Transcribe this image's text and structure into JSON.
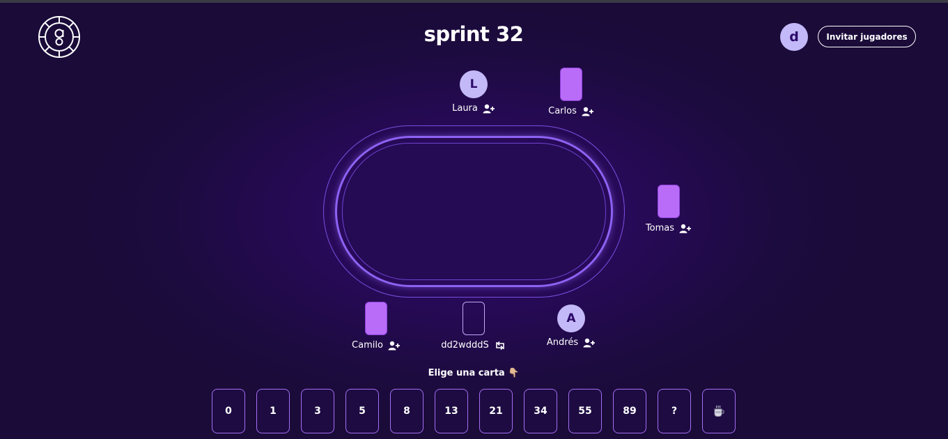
{
  "header": {
    "title": "sprint 32",
    "user_initial": "d",
    "invite_label": "Invitar jugadores"
  },
  "players": [
    {
      "name": "Laura",
      "avatar": "L",
      "state": "avatar",
      "action_icon": "add-user-icon"
    },
    {
      "name": "Carlos",
      "state": "card",
      "action_icon": "add-user-icon"
    },
    {
      "name": "Tomas",
      "state": "card",
      "action_icon": "add-user-icon"
    },
    {
      "name": "Camilo",
      "state": "card",
      "action_icon": "add-user-icon"
    },
    {
      "name": "dd2wdddS",
      "state": "empty-card",
      "action_icon": "swap-icon"
    },
    {
      "name": "Andrés",
      "avatar": "A",
      "state": "avatar",
      "action_icon": "add-user-icon"
    }
  ],
  "prompt": {
    "text": "Elige una carta",
    "emoji": "👇🏼"
  },
  "cards": [
    "0",
    "1",
    "3",
    "5",
    "8",
    "13",
    "21",
    "34",
    "55",
    "89",
    "?",
    "coffee-icon"
  ],
  "colors": {
    "accent": "#b96cf8",
    "avatar_bg": "#c3b8f8",
    "table_border": "#8d62f2",
    "background": "#1c0b3e"
  }
}
